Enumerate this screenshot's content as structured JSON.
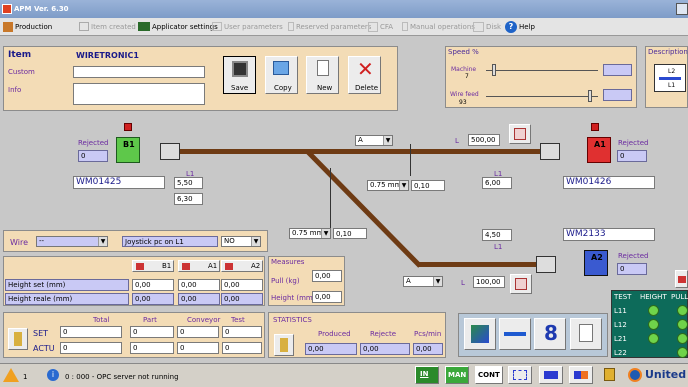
{
  "title": "APM Ver. 6.30",
  "toolbar": {
    "production": "Production",
    "item_created": "Item created",
    "applicator_settings": "Applicator settings",
    "user_parameters": "User parameters",
    "reserved_parameters": "Reserved parameters",
    "cfa": "CFA",
    "manual_operations": "Manual operations",
    "disk": "Disk",
    "help": "Help"
  },
  "item": {
    "title": "Item",
    "name_value": "WIRETRONIC1",
    "custom_label": "Custom",
    "info_label": "Info",
    "save": "Save",
    "copy": "Copy",
    "new": "New",
    "delete": "Delete"
  },
  "speed": {
    "title": "Speed %",
    "machine_label": "Machine",
    "machine_value": "7",
    "wire_feed_label": "Wire feed",
    "wire_feed_value": "93",
    "machine_level": 0.07,
    "wire_feed_level": 0.93
  },
  "description": {
    "title": "Description",
    "l2": "L2",
    "l1": "L1"
  },
  "layout": {
    "dd_a_top": "A",
    "length_top": "L",
    "length_top_value": "500,00",
    "rejected_left": "Rejected",
    "rejected_left_value": "0",
    "b1": "B1",
    "wm_left": "WM01425",
    "l1_left": "L1",
    "v550": "5,50",
    "v630": "6,30",
    "strip1_dd": "0.75 mm",
    "strip1_val": "0,10",
    "l1_right": "L1",
    "v600": "6,00",
    "a1": "A1",
    "rejected_right1": "Rejected",
    "rejected_right1_value": "0",
    "wm_right1": "WM01426",
    "strip2_dd": "0.75 mm",
    "strip2_val": "0,10",
    "v450": "4,50",
    "l1_right2": "L1",
    "wm_right2": "WM2133",
    "a2": "A2",
    "rejected_right2": "Rejected",
    "rejected_right2_value": "0",
    "dd_a_bottom": "A",
    "length_bottom": "L",
    "length_bottom_value": "100,00"
  },
  "wire": {
    "label": "Wire",
    "dd_value": "--",
    "joystick": "Joystick pc on L1",
    "no_value": "NO"
  },
  "heights": {
    "b1": "B1",
    "a1": "A1",
    "a2": "A2",
    "set_label": "Height set (mm)",
    "real_label": "Height reale (mm)",
    "set_b1": "0,00",
    "set_a1": "0,00",
    "set_a2": "0,00",
    "real_b1": "0,00",
    "real_a1": "0,00",
    "real_a2": "0,00"
  },
  "measures": {
    "title": "Measures",
    "pull_label": "Pull (kg)",
    "pull_value": "0,00",
    "height_label": "Height (mm)",
    "height_value": "0,00"
  },
  "test": {
    "test": "TEST",
    "height": "HEIGHT",
    "pull": "PULL",
    "rows": [
      "L11",
      "L12",
      "L21",
      "L22"
    ]
  },
  "counters": {
    "total": "Total",
    "part": "Part",
    "conveyor": "Conveyor",
    "test": "Test",
    "set_label": "SET",
    "actu_label": "ACTU",
    "set_total": "0",
    "set_part": "0",
    "set_conveyor": "0",
    "set_test": "0",
    "actu_total": "0",
    "actu_part": "0",
    "actu_conveyor": "0",
    "actu_test": "0"
  },
  "statistics": {
    "title": "STATISTICS",
    "produced": "Produced",
    "rejecte": "Rejecte",
    "pcs_min": "Pcs/min",
    "produced_value": "0,00",
    "rejecte_value": "0,00",
    "pcs_value": "0,00"
  },
  "status": {
    "num": "1",
    "message": "0 : 000 - OPC server not running",
    "in": "IN",
    "man": "MAN",
    "cont": "CONT",
    "brand": "United"
  }
}
